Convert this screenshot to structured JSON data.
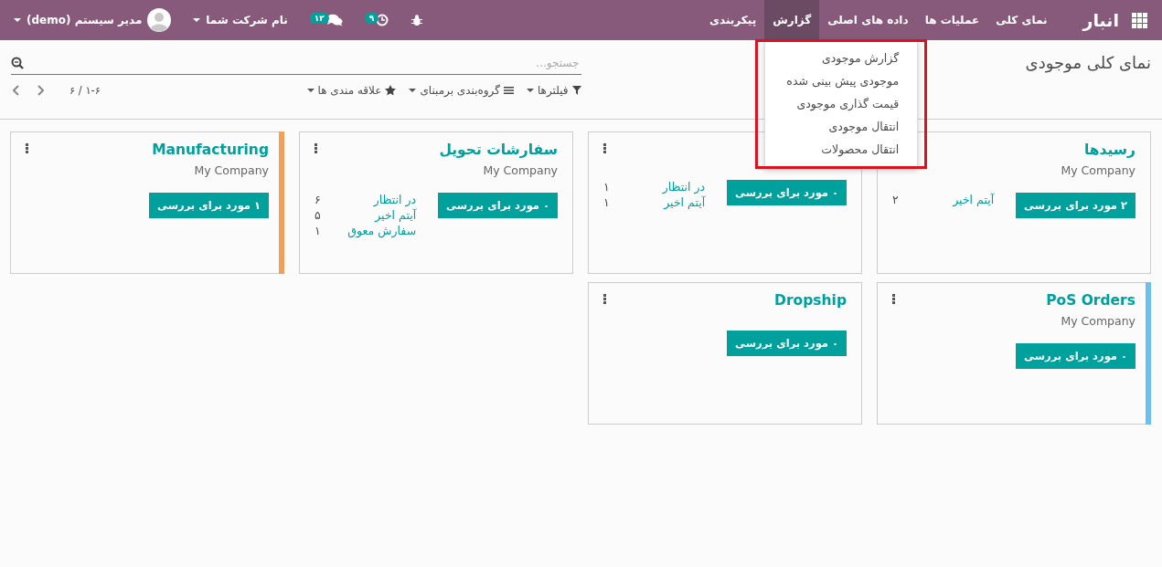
{
  "navbar": {
    "app_title": "انبار",
    "menus": [
      {
        "label": "نمای کلی",
        "selected": false
      },
      {
        "label": "عملیات ها",
        "selected": false
      },
      {
        "label": "داده های اصلی",
        "selected": false
      },
      {
        "label": "گزارش",
        "selected": true
      },
      {
        "label": "پیکربندی",
        "selected": false
      }
    ],
    "activity_count": "۹",
    "message_count": "۱۲",
    "company": "نام شرکت شما",
    "user": "مدیر سیستم (demo)"
  },
  "report_menu": {
    "items": [
      "گزارش موجودی",
      "موجودی پیش بینی شده",
      "قیمت گذاری موجودی",
      "انتقال موجودی",
      "انتقال محصولات"
    ]
  },
  "control_panel": {
    "title": "نمای کلی موجودی",
    "search": {
      "placeholder": "جستجو..."
    },
    "filters": [
      {
        "label": "فیلترها",
        "kind": "filter"
      },
      {
        "label": "گروه‌بندی برمبنای",
        "kind": "group"
      },
      {
        "label": "علاقه مندی ها",
        "kind": "favorite"
      }
    ],
    "pager": "۱-۶ / ۶"
  },
  "cards": [
    {
      "title": "رسیدها",
      "company": "My Company",
      "button": "۲ مورد برای بررسی",
      "stats": [
        {
          "label": "آیتم اخیر",
          "value": "۲"
        }
      ]
    },
    {
      "button": "۰ مورد برای بررسی",
      "stats": [
        {
          "label": "در انتظار",
          "value": "۱"
        },
        {
          "label": "آیتم اخیر",
          "value": "۱"
        }
      ]
    },
    {
      "title": "سفارشات تحویل",
      "company": "My Company",
      "button": "۰ مورد برای بررسی",
      "stats": [
        {
          "label": "در انتظار",
          "value": "۶"
        },
        {
          "label": "آیتم اخیر",
          "value": "۵"
        },
        {
          "label": "سفارش معوق",
          "value": "۱"
        }
      ]
    },
    {
      "title": "Manufacturing",
      "company": "My Company",
      "button": "۱ مورد برای بررسی",
      "color": "#f0a05a"
    },
    {
      "title": "PoS Orders",
      "company": "My Company",
      "button": "۰ مورد برای بررسی",
      "color": "#6cc1ed"
    },
    {
      "title": "Dropship",
      "button": "۰ مورد برای بررسی"
    }
  ]
}
